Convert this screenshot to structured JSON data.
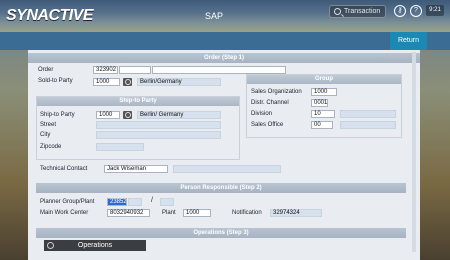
{
  "header": {
    "logo": "SYNACTIVE",
    "title": "SAP",
    "transaction_placeholder": "Transaction",
    "time": "9:21",
    "return_label": "Return"
  },
  "order_section": {
    "title": "Order (Step 1)",
    "order_label": "Order",
    "order_value": "323902",
    "sold_to_label": "Sold-to Party",
    "sold_to_value": "1000",
    "sold_to_desc": "Berlin/Germany"
  },
  "ship_to": {
    "title": "Ship-to Party",
    "ship_to_label": "Ship-to Party",
    "ship_to_value": "1000",
    "ship_to_desc": "Berlin/ Germany",
    "street_label": "Street",
    "city_label": "City",
    "zip_label": "Zipcode"
  },
  "group": {
    "title": "Group",
    "sales_org_label": "Sales Organization",
    "sales_org_value": "1000",
    "distr_label": "Distr. Channel",
    "distr_value": "0001",
    "division_label": "Division",
    "division_value": "10",
    "sales_office_label": "Sales Office",
    "sales_office_value": "00"
  },
  "technical_contact": {
    "label": "Technical Contact",
    "value": "Jack Wiseman"
  },
  "person_section": {
    "title": "Person Responsible (Step 2)",
    "planner_label": "Planner Group/Plant",
    "planner_value": "23852",
    "slash": "/",
    "work_center_label": "Main Work Center",
    "work_center_value": "8032940932",
    "plant_label": "Plant",
    "plant_value": "1000",
    "notification_label": "Notification",
    "notification_value": "32974324"
  },
  "operations_section": {
    "title": "Operations (Step 3)",
    "button_label": "Operations"
  }
}
